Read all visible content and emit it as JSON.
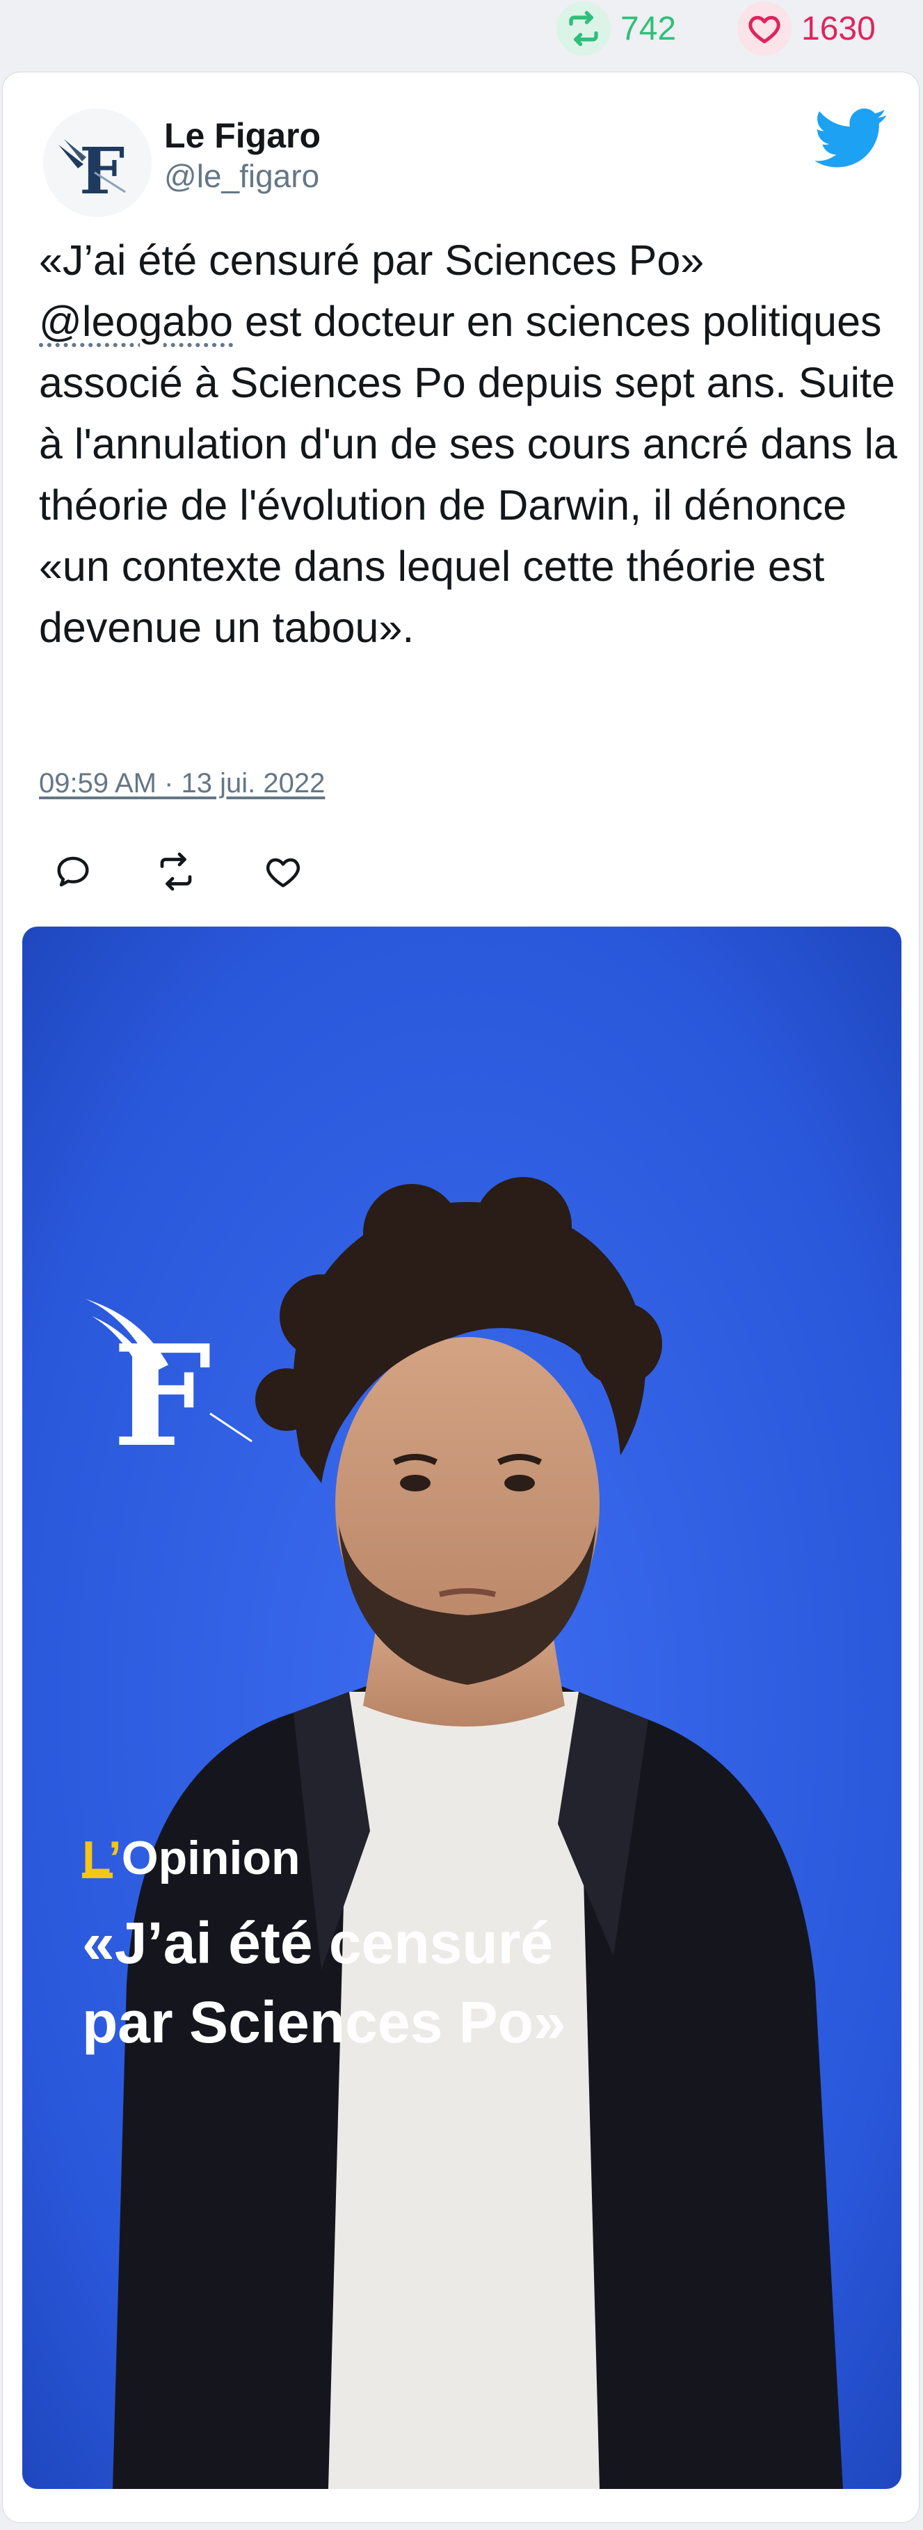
{
  "stats": {
    "retweets": "742",
    "likes": "1630"
  },
  "author": {
    "name": "Le Figaro",
    "handle": "@le_figaro",
    "avatar_letter": "F"
  },
  "tweet": {
    "text_line1": "«J’ai été censuré par Sciences Po»",
    "mention": "@leogabo",
    "text_rest": " est docteur en sciences politiques associé à Sciences Po depuis sept ans. Suite à l'annulation d'un de ses cours ancré dans la théorie de l'évolution de Darwin, il dénonce «un contexte dans lequel cette théorie est devenue un tabou».",
    "timestamp": "09:59 AM · 13 jui. 2022"
  },
  "media": {
    "logo_letter": "F",
    "brand_prefix": "L’",
    "brand_rest": "Opinion",
    "caption_line1": "«J’ai été censuré",
    "caption_line2": "par Sciences Po»"
  },
  "icons": {
    "retweet": "retweet-icon",
    "like": "heart-icon",
    "reply": "reply-icon",
    "twitter": "twitter-bird-icon"
  },
  "colors": {
    "retweet": "#2fbf7a",
    "like": "#e0245e",
    "twitter_blue": "#1da1f2",
    "media_background": "#2f57d8",
    "figaro_navy": "#1e3a5f"
  }
}
